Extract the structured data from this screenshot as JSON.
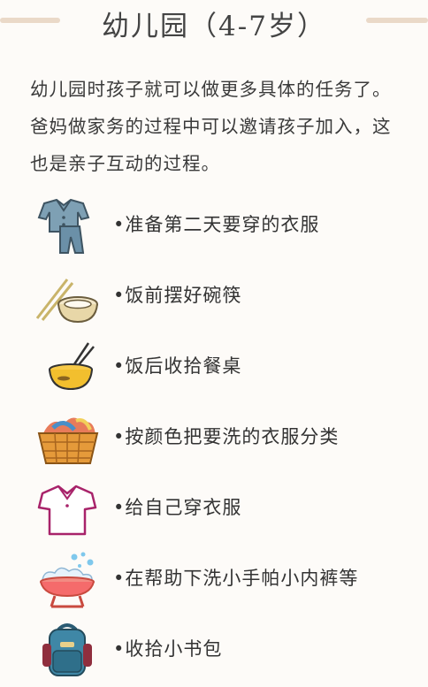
{
  "header": {
    "title": "幼儿园（4-7岁）"
  },
  "intro": "幼儿园时孩子就可以做更多具体的任务了。爸妈做家务的过程中可以邀请孩子加入，这也是亲子互动的过程。",
  "items": [
    {
      "label": "•准备第二天要穿的衣服",
      "icon": "clothes-icon"
    },
    {
      "label": "•饭前摆好碗筷",
      "icon": "bowl-chopsticks-icon"
    },
    {
      "label": "•饭后收拾餐桌",
      "icon": "rice-bowl-icon"
    },
    {
      "label": "•按颜色把要洗的衣服分类",
      "icon": "laundry-basket-icon"
    },
    {
      "label": "•给自己穿衣服",
      "icon": "shirt-icon"
    },
    {
      "label": "•在帮助下洗小手帕小内裤等",
      "icon": "wash-basin-icon"
    },
    {
      "label": "•收拾小书包",
      "icon": "backpack-icon"
    }
  ]
}
